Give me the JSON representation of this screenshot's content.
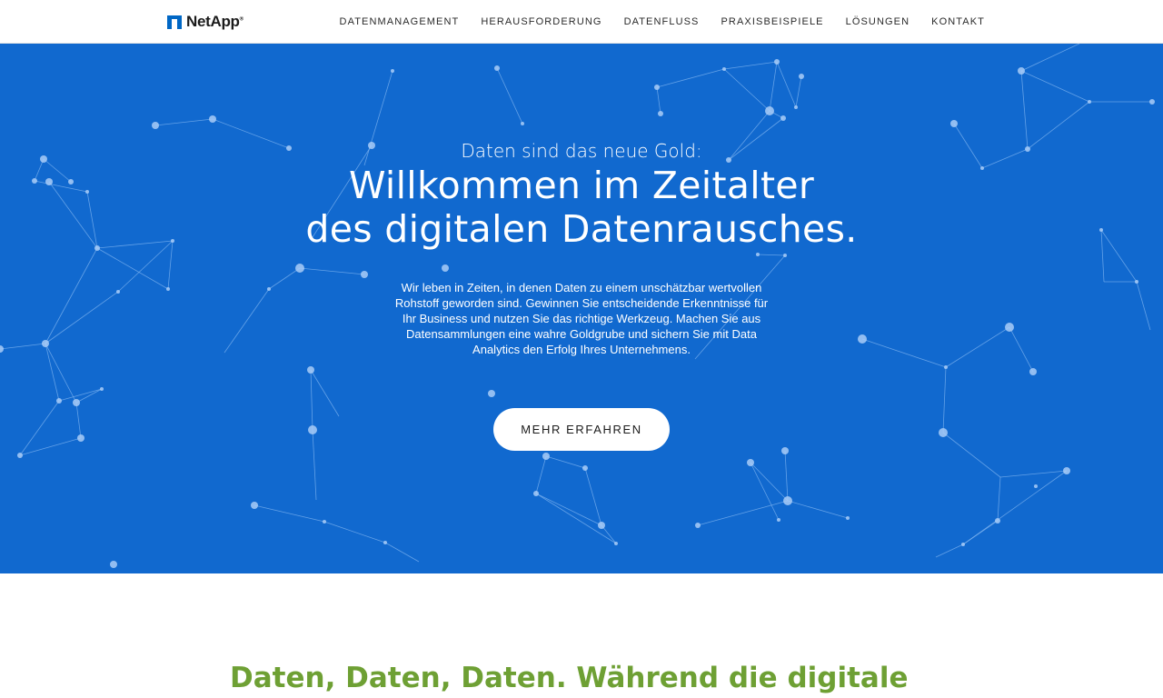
{
  "header": {
    "logo_text": "NetApp",
    "logo_reg": "®",
    "nav": [
      {
        "label": "DATENMANAGEMENT"
      },
      {
        "label": "HERAUSFORDERUNG"
      },
      {
        "label": "DATENFLUSS"
      },
      {
        "label": "PRAXISBEISPIELE"
      },
      {
        "label": "LÖSUNGEN"
      },
      {
        "label": "KONTAKT"
      }
    ]
  },
  "hero": {
    "kicker": "Daten sind das neue Gold:",
    "title_line1": "Willkommen im Zeitalter",
    "title_line2": "des digitalen Datenrausches.",
    "body": "Wir leben in Zeiten, in denen Daten zu einem unschätzbar wertvollen Rohstoff geworden sind. Gewinnen Sie entscheidende Erkenntnisse für Ihr Business und nutzen Sie das richtige Werkzeug. Machen Sie aus Datensammlungen eine wahre Goldgrube und sichern Sie mit Data Analytics den Erfolg Ihres Unternehmens.",
    "cta_label": "MEHR ERFAHREN"
  },
  "section": {
    "heading": "Daten, Daten, Daten. Während die digitale"
  },
  "colors": {
    "hero_bg": "#1169cf",
    "heading_green": "#6ea034",
    "network_line": "#7fb4f0",
    "network_node": "#a9cdf7"
  },
  "icons": {
    "logo": "netapp-logo-mark-icon",
    "background": "network-graph-decoration"
  }
}
